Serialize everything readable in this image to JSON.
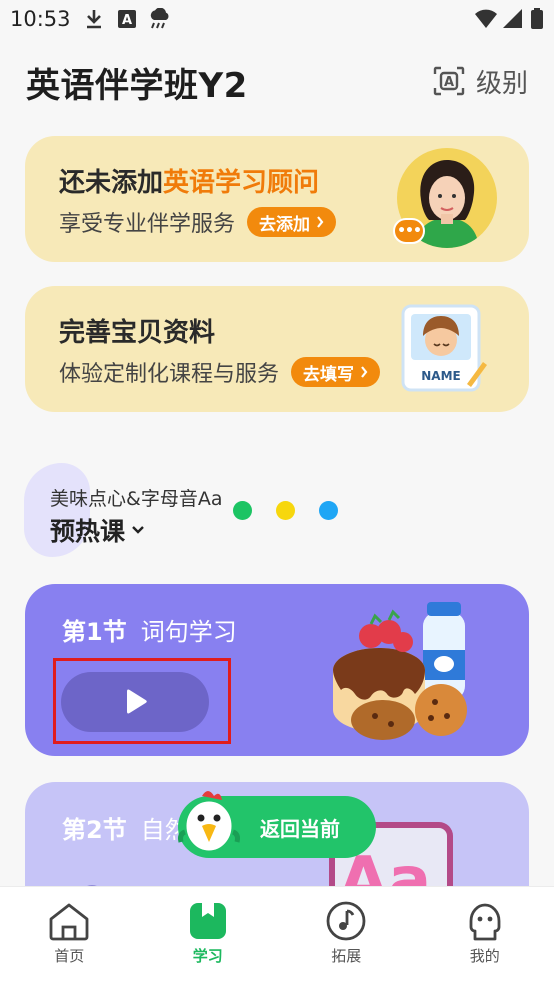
{
  "status_bar": {
    "time": "10:53"
  },
  "header": {
    "title": "英语伴学班Y2",
    "level_label": "级别",
    "level_icon": "A"
  },
  "advisor_card": {
    "title_prefix": "还未添加",
    "title_accent": "英语学习顾问",
    "subtitle": "享受专业伴学服务",
    "button_label": "去添加",
    "bubble_text": "•••"
  },
  "profile_card": {
    "title": "完善宝贝资料",
    "subtitle": "体验定制化课程与服务",
    "button_label": "去填写",
    "badge_text": "NAME"
  },
  "course": {
    "name": "美味点心&字母音Aa",
    "type": "预热课"
  },
  "dots": {
    "colors": [
      "#1cc463",
      "#f7d70d",
      "#1fa6f5"
    ]
  },
  "lessons": [
    {
      "number": "第1节",
      "title": "词句学习"
    },
    {
      "number": "第2节",
      "title": "自然"
    }
  ],
  "return_button": {
    "label": "返回当前"
  },
  "nav": [
    {
      "label": "首页",
      "icon": "home-icon"
    },
    {
      "label": "学习",
      "icon": "book-icon"
    },
    {
      "label": "拓展",
      "icon": "music-note-icon"
    },
    {
      "label": "我的",
      "icon": "profile-icon"
    }
  ],
  "colors": {
    "brand_green": "#1cb85e",
    "accent_orange": "#f28a0d",
    "lesson_purple": "#8880f0"
  }
}
